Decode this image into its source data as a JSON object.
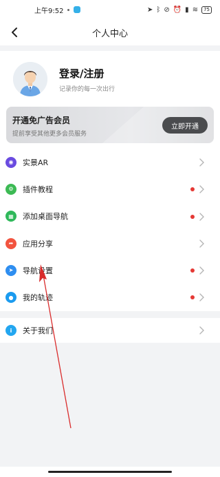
{
  "status_bar": {
    "time": "上午9:52",
    "battery": "75"
  },
  "nav": {
    "title": "个人中心"
  },
  "profile": {
    "login_title": "登录/注册",
    "login_subtitle": "记录你的每一次出行"
  },
  "vip": {
    "title": "开通免广告会员",
    "subtitle": "提前享受其他更多会员服务",
    "button": "立即开通"
  },
  "menu": [
    {
      "label": "实景AR",
      "icon": "ar-icon",
      "color": "#6a4be0",
      "dot": false
    },
    {
      "label": "插件教程",
      "icon": "plugin-icon",
      "color": "#3cba54",
      "dot": true
    },
    {
      "label": "添加桌面导航",
      "icon": "grid-icon",
      "color": "#2fb85a",
      "dot": true
    },
    {
      "label": "应用分享",
      "icon": "share-icon",
      "color": "#f2543f",
      "dot": false
    },
    {
      "label": "导航设置",
      "icon": "navigation-icon",
      "color": "#2e8ef0",
      "dot": true
    },
    {
      "label": "我的轨迹",
      "icon": "track-icon",
      "color": "#1b9bef",
      "dot": true
    }
  ],
  "about": {
    "label": "关于我们",
    "icon": "info-icon",
    "color": "#23a6f0"
  },
  "colors": {
    "accent_red": "#e53935",
    "annotation_arrow": "#d92b2b"
  }
}
